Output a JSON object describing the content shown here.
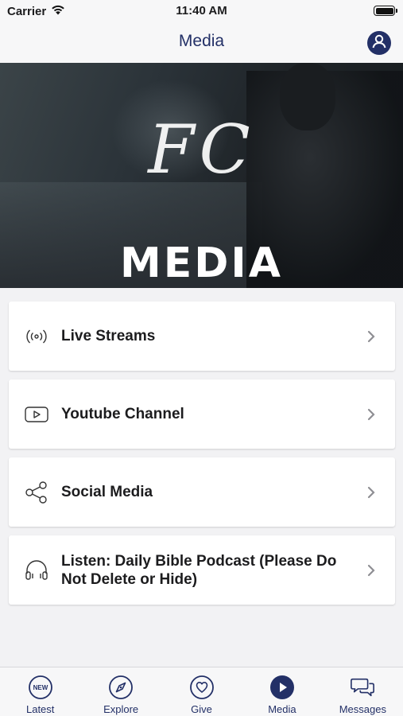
{
  "status_bar": {
    "carrier": "Carrier",
    "time": "11:40 AM"
  },
  "header": {
    "title": "Media",
    "profile_icon": "person-circle-icon"
  },
  "hero": {
    "script_text": "FC",
    "title": "MEDIA"
  },
  "menu": {
    "items": [
      {
        "label": "Live Streams",
        "icon": "broadcast-icon"
      },
      {
        "label": "Youtube Channel",
        "icon": "video-play-icon"
      },
      {
        "label": "Social Media",
        "icon": "share-icon"
      },
      {
        "label": "Listen: Daily Bible Podcast (Please Do Not Delete or Hide)",
        "icon": "headphones-icon"
      }
    ]
  },
  "tab_bar": {
    "tabs": [
      {
        "label": "Latest",
        "icon": "new-badge-icon",
        "badge_text": "NEW",
        "selected": false
      },
      {
        "label": "Explore",
        "icon": "compass-icon",
        "selected": false
      },
      {
        "label": "Give",
        "icon": "heart-icon",
        "selected": false
      },
      {
        "label": "Media",
        "icon": "play-icon",
        "selected": true
      },
      {
        "label": "Messages",
        "icon": "chat-bubbles-icon",
        "selected": false
      }
    ]
  },
  "colors": {
    "brand": "#233067",
    "background": "#f2f2f4",
    "card": "#ffffff"
  }
}
